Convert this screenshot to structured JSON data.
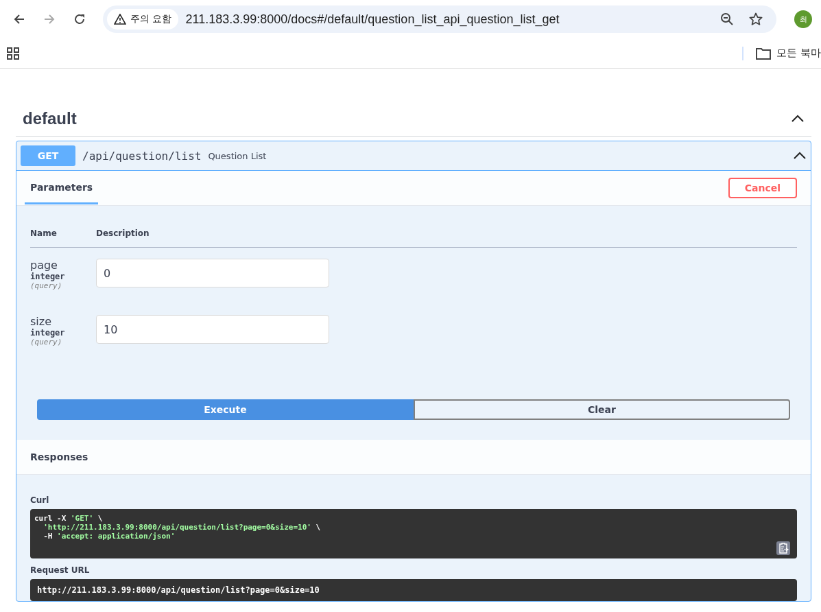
{
  "browser": {
    "security_chip": "주의 요함",
    "url": "211.183.3.99:8000/docs#/default/question_list_api_question_list_get",
    "profile_initial": "최",
    "bookmarks_folder": "모든 북마"
  },
  "section": {
    "title": "default",
    "expanded": true
  },
  "operation": {
    "method": "GET",
    "path": "/api/question/list",
    "summary": "Question List",
    "expanded": true,
    "tabs": [
      {
        "label": "Parameters",
        "selected": true
      }
    ],
    "cancel_button": "Cancel",
    "param_columns": [
      "Name",
      "Description"
    ],
    "params": [
      {
        "name": "page",
        "type": "integer",
        "location": "(query)",
        "value": "0"
      },
      {
        "name": "size",
        "type": "integer",
        "location": "(query)",
        "value": "10"
      }
    ],
    "execute_button": "Execute",
    "clear_button": "Clear",
    "responses_title": "Responses",
    "curl_label": "Curl",
    "curl_lines": [
      {
        "indented": false,
        "segments": [
          {
            "kind": "plain",
            "text": "curl -X "
          },
          {
            "kind": "string",
            "text": "'GET'"
          },
          {
            "kind": "plain",
            "text": " \\"
          }
        ]
      },
      {
        "indented": true,
        "segments": [
          {
            "kind": "string",
            "text": "'http://211.183.3.99:8000/api/question/list?page=0&size=10'"
          },
          {
            "kind": "plain",
            "text": " \\"
          }
        ]
      },
      {
        "indented": true,
        "segments": [
          {
            "kind": "plain",
            "text": "-H "
          },
          {
            "kind": "string",
            "text": "'accept: application/json'"
          }
        ]
      }
    ],
    "request_url_label": "Request URL",
    "request_url": "http://211.183.3.99:8000/api/question/list?page=0&size=10"
  }
}
